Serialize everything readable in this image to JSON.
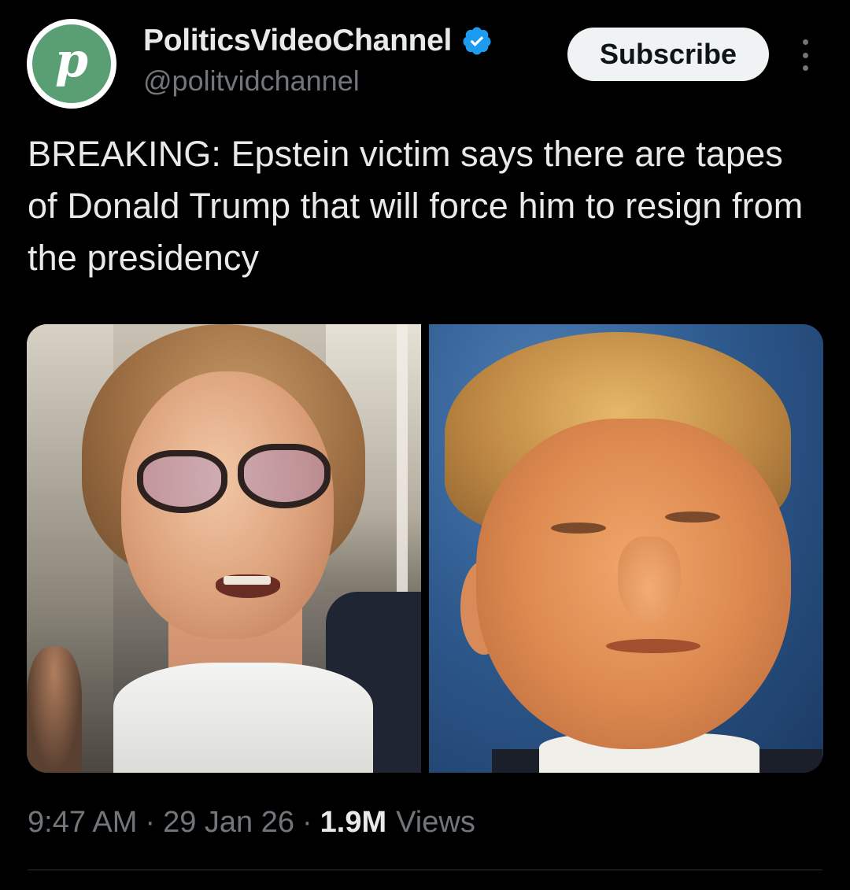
{
  "author": {
    "display_name": "PoliticsVideoChannel",
    "handle": "@politvidchannel",
    "avatar_letter": "p",
    "avatar_color": "#5a9e73",
    "verified": true,
    "verified_icon": "verified-badge-icon",
    "verified_color": "#1d9bf0"
  },
  "actions": {
    "subscribe_label": "Subscribe",
    "more_icon": "more-vertical-icon"
  },
  "tweet": {
    "text": "BREAKING: Epstein victim says there are tapes of Donald Trump that will force him to resign from the presidency"
  },
  "media": {
    "count": 2
  },
  "meta": {
    "time": "9:47 AM",
    "date": "29 Jan 26",
    "separator": "·",
    "views_count": "1.9M",
    "views_label": "Views"
  },
  "colors": {
    "background": "#000000",
    "primary_text": "#e7e9ea",
    "secondary_text": "#71767b",
    "button_bg": "#eff3f4"
  }
}
